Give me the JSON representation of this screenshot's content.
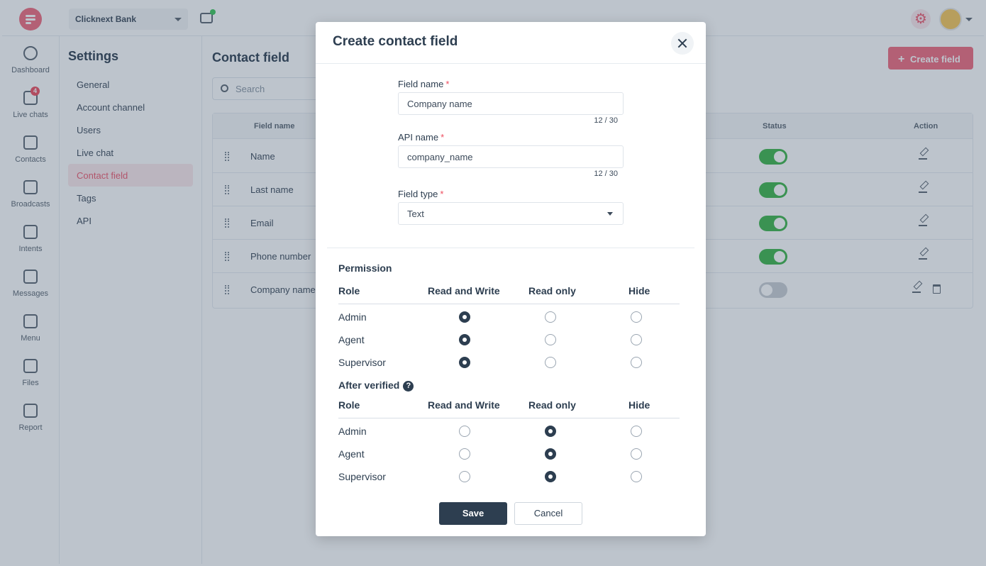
{
  "topbar": {
    "workspace": "Clicknext Bank",
    "icons": {
      "logo": "brand-logo-icon",
      "chat": "chat-notification-icon",
      "settings": "gear-icon",
      "avatar": "user-avatar"
    }
  },
  "nav": {
    "items": [
      {
        "label": "Dashboard",
        "icon": "pie-chart-icon"
      },
      {
        "label": "Live chats",
        "icon": "chat-bubbles-icon",
        "badge": "4"
      },
      {
        "label": "Contacts",
        "icon": "contact-card-icon"
      },
      {
        "label": "Broadcasts",
        "icon": "megaphone-icon"
      },
      {
        "label": "Intents",
        "icon": "ai-icon"
      },
      {
        "label": "Messages",
        "icon": "text-message-icon"
      },
      {
        "label": "Menu",
        "icon": "grid-menu-icon"
      },
      {
        "label": "Files",
        "icon": "folder-icon"
      },
      {
        "label": "Report",
        "icon": "bar-chart-icon"
      }
    ]
  },
  "settings": {
    "title": "Settings",
    "items": [
      "General",
      "Account channel",
      "Users",
      "Live chat",
      "Contact field",
      "Tags",
      "API"
    ],
    "active": "Contact field"
  },
  "main": {
    "title": "Contact field",
    "create_button": "Create field",
    "search_placeholder": "Search",
    "columns": {
      "field_name": "Field name",
      "status": "Status",
      "action": "Action"
    },
    "rows": [
      {
        "name": "Name",
        "enabled": true
      },
      {
        "name": "Last name",
        "enabled": true
      },
      {
        "name": "Email",
        "enabled": true
      },
      {
        "name": "Phone number",
        "enabled": true
      },
      {
        "name": "Company name",
        "enabled": false
      }
    ]
  },
  "modal": {
    "title": "Create contact field",
    "field_name_label": "Field name",
    "field_name_value": "Company name",
    "field_name_count": "12 / 30",
    "api_name_label": "API name",
    "api_name_value": "company_name",
    "api_name_count": "12 / 30",
    "field_type_label": "Field type",
    "field_type_value": "Text",
    "required_mark": "*",
    "permission_title": "Permission",
    "after_verified_title": "After verified",
    "help_glyph": "?",
    "columns": {
      "role": "Role",
      "read_write": "Read and Write",
      "read_only": "Read only",
      "hide": "Hide"
    },
    "permission_rows": [
      {
        "role": "Admin",
        "selected": "read_write"
      },
      {
        "role": "Agent",
        "selected": "read_write"
      },
      {
        "role": "Supervisor",
        "selected": "read_write"
      }
    ],
    "after_verified_rows": [
      {
        "role": "Admin",
        "selected": "read_only"
      },
      {
        "role": "Agent",
        "selected": "read_only"
      },
      {
        "role": "Supervisor",
        "selected": "read_only"
      }
    ],
    "save_label": "Save",
    "cancel_label": "Cancel"
  }
}
